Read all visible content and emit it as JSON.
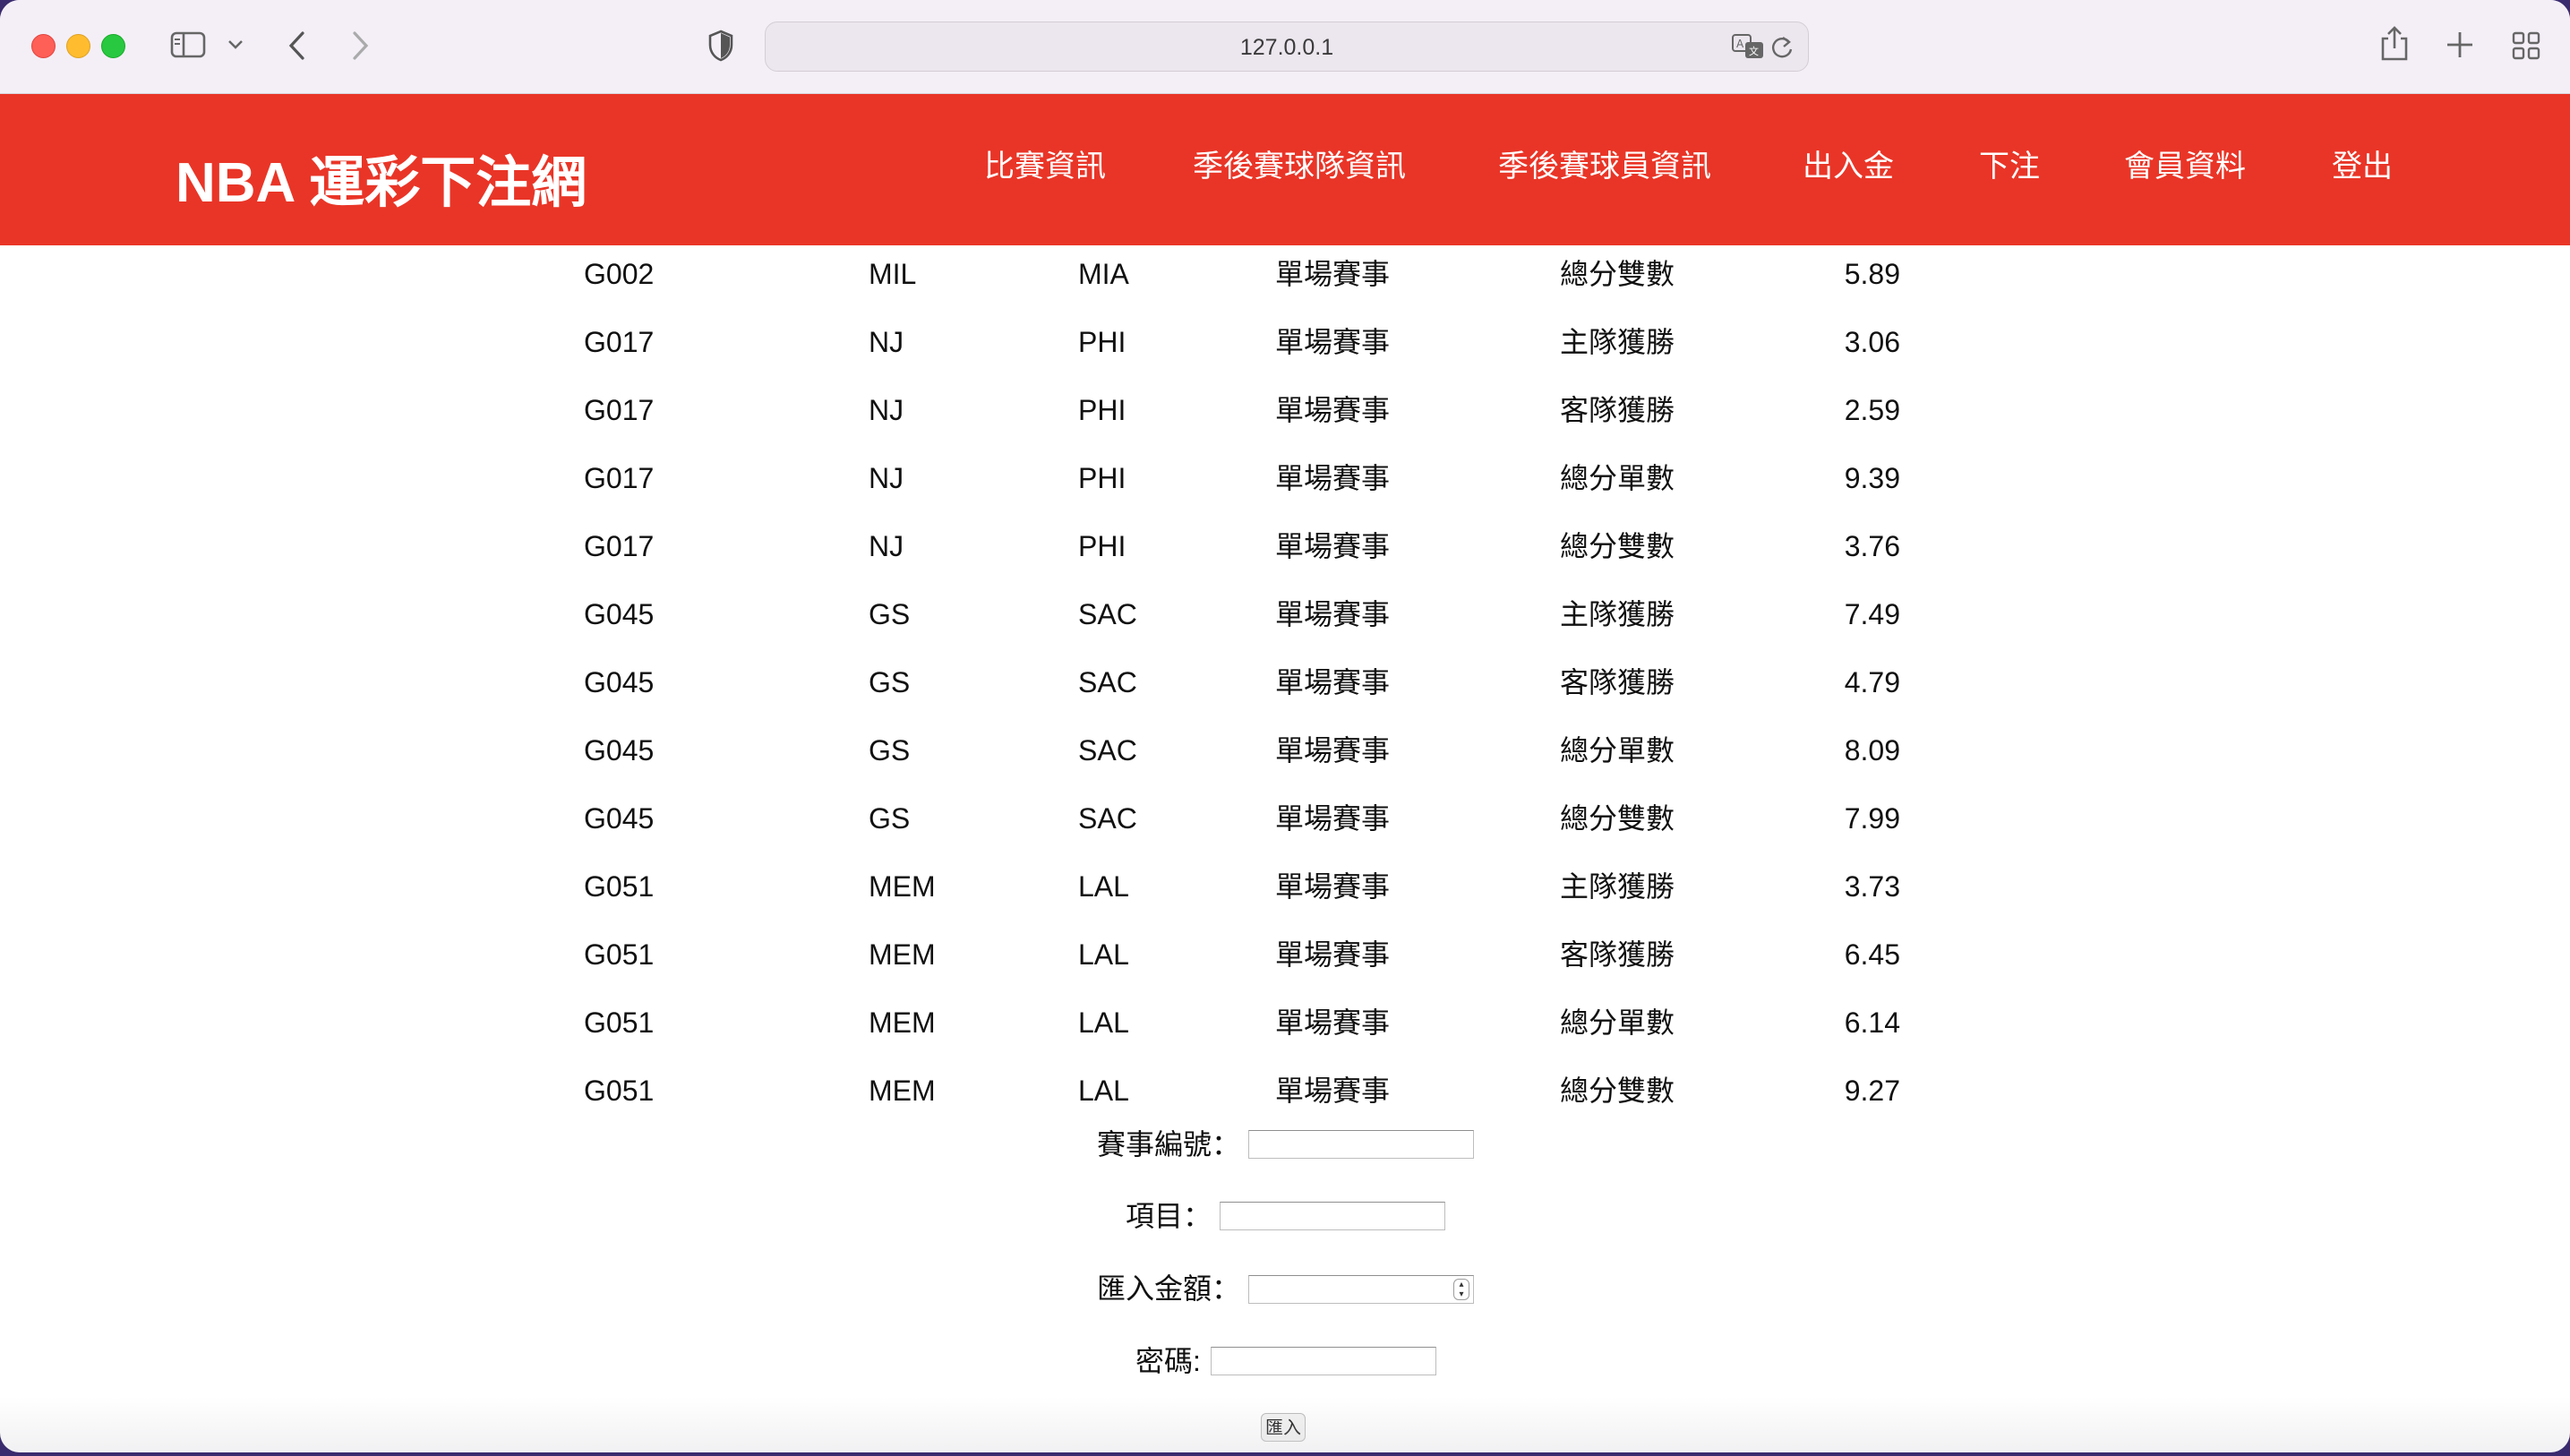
{
  "browser": {
    "url": "127.0.0.1",
    "icons": [
      "sidebar-icon",
      "chevron-down-icon",
      "back-icon",
      "forward-icon",
      "shield-icon",
      "translate-icon",
      "reload-icon",
      "share-icon",
      "new-tab-icon",
      "tab-overview-icon"
    ]
  },
  "header": {
    "brand": "NBA 運彩下注網",
    "nav": [
      "比賽資訊",
      "季後賽球隊資訊",
      "季後賽球員資訊",
      "出入金",
      "下注",
      "會員資料",
      "登出"
    ],
    "color": "#e93527"
  },
  "table": {
    "rows": [
      [
        "G002",
        "MIL",
        "MIA",
        "單場賽事",
        "總分雙數",
        "5.89"
      ],
      [
        "G017",
        "NJ",
        "PHI",
        "單場賽事",
        "主隊獲勝",
        "3.06"
      ],
      [
        "G017",
        "NJ",
        "PHI",
        "單場賽事",
        "客隊獲勝",
        "2.59"
      ],
      [
        "G017",
        "NJ",
        "PHI",
        "單場賽事",
        "總分單數",
        "9.39"
      ],
      [
        "G017",
        "NJ",
        "PHI",
        "單場賽事",
        "總分雙數",
        "3.76"
      ],
      [
        "G045",
        "GS",
        "SAC",
        "單場賽事",
        "主隊獲勝",
        "7.49"
      ],
      [
        "G045",
        "GS",
        "SAC",
        "單場賽事",
        "客隊獲勝",
        "4.79"
      ],
      [
        "G045",
        "GS",
        "SAC",
        "單場賽事",
        "總分單數",
        "8.09"
      ],
      [
        "G045",
        "GS",
        "SAC",
        "單場賽事",
        "總分雙數",
        "7.99"
      ],
      [
        "G051",
        "MEM",
        "LAL",
        "單場賽事",
        "主隊獲勝",
        "3.73"
      ],
      [
        "G051",
        "MEM",
        "LAL",
        "單場賽事",
        "客隊獲勝",
        "6.45"
      ],
      [
        "G051",
        "MEM",
        "LAL",
        "單場賽事",
        "總分單數",
        "6.14"
      ],
      [
        "G051",
        "MEM",
        "LAL",
        "單場賽事",
        "總分雙數",
        "9.27"
      ]
    ]
  },
  "form": {
    "game_id_label": "賽事編號：",
    "item_label": "項目：",
    "amount_label": "匯入金額：",
    "password_label": "密碼:",
    "game_id_value": "",
    "item_value": "",
    "amount_value": "",
    "password_value": "",
    "submit_label": "匯入"
  }
}
